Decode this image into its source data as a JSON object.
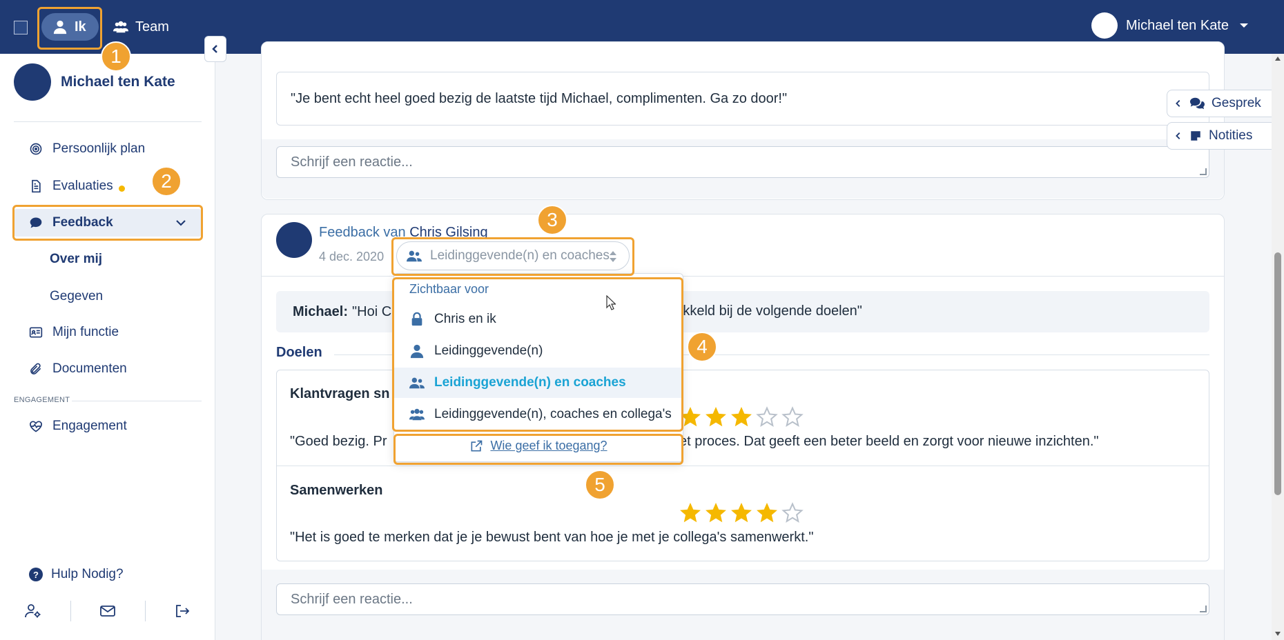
{
  "topbar": {
    "ik_label": "Ik",
    "team_label": "Team",
    "user_name": "Michael ten Kate"
  },
  "sidebar": {
    "profile_name": "Michael ten Kate",
    "items": [
      {
        "label": "Persoonlijk plan",
        "icon": "target-icon"
      },
      {
        "label": "Evaluaties",
        "icon": "document-icon",
        "badge": "dot"
      },
      {
        "label": "Feedback",
        "icon": "chat-icon",
        "active": true
      },
      {
        "label": "Mijn functie",
        "icon": "id-card-icon"
      },
      {
        "label": "Documenten",
        "icon": "paperclip-icon"
      },
      {
        "label": "Engagement",
        "icon": "heart-pulse-icon"
      }
    ],
    "feedback_sub": [
      "Over mij",
      "Gegeven"
    ],
    "section_label": "ENGAGEMENT",
    "help_label": "Hulp Nodig?",
    "footer_icons": [
      "user-settings-icon",
      "mail-icon",
      "logout-icon"
    ]
  },
  "right_tabs": {
    "gesprek": "Gesprek",
    "notities": "Notities"
  },
  "previous_card": {
    "quote": "\"Je bent echt heel goed bezig de laatste tijd Michael, complimenten. Ga zo door!\"",
    "reply_placeholder": "Schrijf een reactie..."
  },
  "feedback_card": {
    "title_prefix": "Feedback van",
    "author": "Chris Gilsing",
    "date": "4 dec. 2020",
    "visibility_selected": "Leidinggevende(n) en coaches",
    "message_author": "Michael:",
    "message_start": "\"Hoi C",
    "message_end": "b ontwikkeld bij de volgende doelen\"",
    "goals_heading": "Doelen",
    "goals": [
      {
        "title": "Klantvragen sn",
        "rating": 3,
        "max": 5,
        "comment_start": "\"Goed bezig. Pr",
        "comment_end": "et proces. Dat geeft een beter beeld en zorgt voor nieuwe inzichten.\""
      },
      {
        "title": "Samenwerken",
        "rating": 4,
        "max": 5,
        "comment": "\"Het is goed te merken dat je je bewust bent van hoe je met je collega's samenwerkt.\""
      }
    ],
    "reply_placeholder": "Schrijf een reactie..."
  },
  "dropdown": {
    "header": "Zichtbaar voor",
    "options": [
      {
        "label": "Chris en ik",
        "icon": "lock-icon"
      },
      {
        "label": "Leidinggevende(n)",
        "icon": "user-icon"
      },
      {
        "label": "Leidinggevende(n) en coaches",
        "icon": "users-icon",
        "selected": true
      },
      {
        "label": "Leidinggevende(n), coaches en collega's",
        "icon": "users-group-icon"
      }
    ],
    "footer_link": "Wie geef ik toegang?"
  },
  "annotations": [
    "1",
    "2",
    "3",
    "4",
    "5"
  ],
  "colors": {
    "accent": "#1f3a73",
    "highlight": "#f0a231",
    "star": "#f5b800",
    "selected_text": "#1aa3d4"
  }
}
